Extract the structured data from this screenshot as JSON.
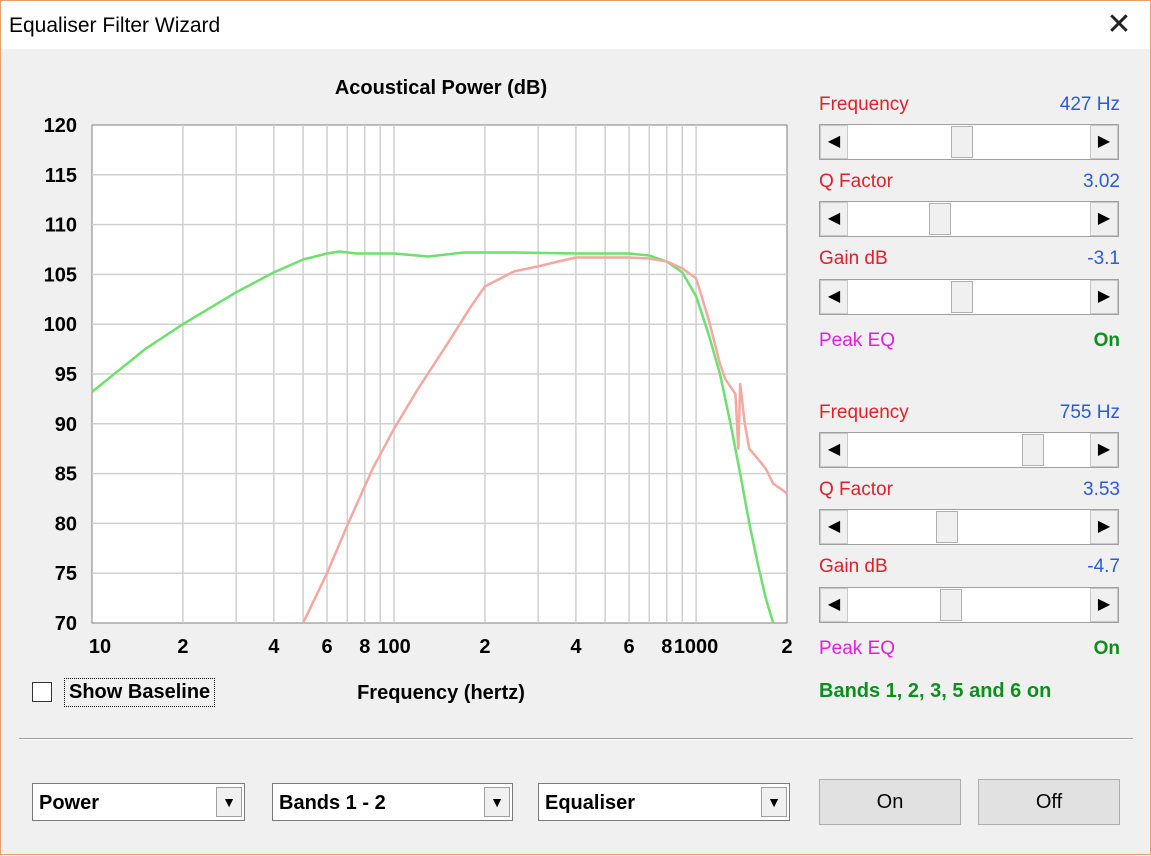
{
  "window": {
    "title": "Equaliser Filter Wizard",
    "close_glyph": "✕"
  },
  "chart_data": {
    "type": "line",
    "title": "Acoustical Power (dB)",
    "xlabel": "Frequency (hertz)",
    "ylabel": "",
    "xscale": "log",
    "xlim": [
      10,
      2000
    ],
    "ylim": [
      70,
      120
    ],
    "grid": true,
    "yticks": [
      "120",
      "115",
      "110",
      "105",
      "100",
      "95",
      "90",
      "85",
      "80",
      "75",
      "70"
    ],
    "xticks": [
      {
        "v": 10,
        "t": "10"
      },
      {
        "v": 20,
        "t": "2"
      },
      {
        "v": 40,
        "t": "4"
      },
      {
        "v": 60,
        "t": "6"
      },
      {
        "v": 80,
        "t": "8"
      },
      {
        "v": 100,
        "t": "100"
      },
      {
        "v": 200,
        "t": "2"
      },
      {
        "v": 400,
        "t": "4"
      },
      {
        "v": 600,
        "t": "6"
      },
      {
        "v": 800,
        "t": "8"
      },
      {
        "v": 1000,
        "t": "1000"
      },
      {
        "v": 2000,
        "t": "2"
      }
    ],
    "series": [
      {
        "color": "#6de06d",
        "points": [
          [
            10,
            93.2
          ],
          [
            15,
            97.5
          ],
          [
            20,
            100
          ],
          [
            30,
            103.2
          ],
          [
            40,
            105.2
          ],
          [
            50,
            106.5
          ],
          [
            60,
            107.1
          ],
          [
            66,
            107.3
          ],
          [
            75,
            107.1
          ],
          [
            100,
            107.1
          ],
          [
            130,
            106.8
          ],
          [
            170,
            107.2
          ],
          [
            250,
            107.2
          ],
          [
            400,
            107.1
          ],
          [
            600,
            107.1
          ],
          [
            700,
            106.9
          ],
          [
            800,
            106.3
          ],
          [
            900,
            105.2
          ],
          [
            1000,
            102.8
          ],
          [
            1100,
            99
          ],
          [
            1200,
            95
          ],
          [
            1300,
            90
          ],
          [
            1400,
            85
          ],
          [
            1500,
            80
          ],
          [
            1600,
            76
          ],
          [
            1700,
            72.5
          ],
          [
            1800,
            70
          ]
        ]
      },
      {
        "color": "#f4a8a0",
        "points": [
          [
            50,
            70
          ],
          [
            60,
            75
          ],
          [
            70,
            79.8
          ],
          [
            85,
            85.5
          ],
          [
            100,
            89.5
          ],
          [
            120,
            93.5
          ],
          [
            150,
            98
          ],
          [
            180,
            101.8
          ],
          [
            200,
            103.8
          ],
          [
            250,
            105.3
          ],
          [
            300,
            105.8
          ],
          [
            350,
            106.3
          ],
          [
            400,
            106.7
          ],
          [
            600,
            106.7
          ],
          [
            700,
            106.6
          ],
          [
            800,
            106.3
          ],
          [
            900,
            105.6
          ],
          [
            1000,
            104.6
          ],
          [
            1100,
            100.5
          ],
          [
            1200,
            96
          ],
          [
            1250,
            94.5
          ],
          [
            1350,
            93
          ],
          [
            1380,
            87.5
          ],
          [
            1400,
            94
          ],
          [
            1450,
            90
          ],
          [
            1500,
            87.5
          ],
          [
            1600,
            86.5
          ],
          [
            1700,
            85.5
          ],
          [
            1800,
            84
          ],
          [
            1900,
            83.5
          ],
          [
            2000,
            83
          ]
        ]
      }
    ]
  },
  "bands": [
    {
      "freq_label": "Frequency",
      "freq_value": "427 Hz",
      "freq_pos": 0.47,
      "q_label": "Q Factor",
      "q_value": "3.02",
      "q_pos": 0.37,
      "gain_label": "Gain  dB",
      "gain_value": "-3.1",
      "gain_pos": 0.47,
      "type_label": "Peak EQ",
      "type_state": "On"
    },
    {
      "freq_label": "Frequency",
      "freq_value": "755 Hz",
      "freq_pos": 0.79,
      "q_label": "Q Factor",
      "q_value": "3.53",
      "q_pos": 0.4,
      "gain_label": "Gain  dB",
      "gain_value": "-4.7",
      "gain_pos": 0.42,
      "type_label": "Peak EQ",
      "type_state": "On"
    }
  ],
  "scroll_arrows": {
    "left": "◀",
    "right": "▶"
  },
  "status": "Bands 1, 2, 3, 5 and 6 on",
  "baseline": {
    "label": "Show Baseline",
    "checked": false
  },
  "combos": [
    {
      "value": "Power"
    },
    {
      "value": "Bands 1 - 2"
    },
    {
      "value": "Equaliser"
    }
  ],
  "dropdown_glyph": "▼",
  "buttons": {
    "on": "On",
    "off": "Off"
  }
}
